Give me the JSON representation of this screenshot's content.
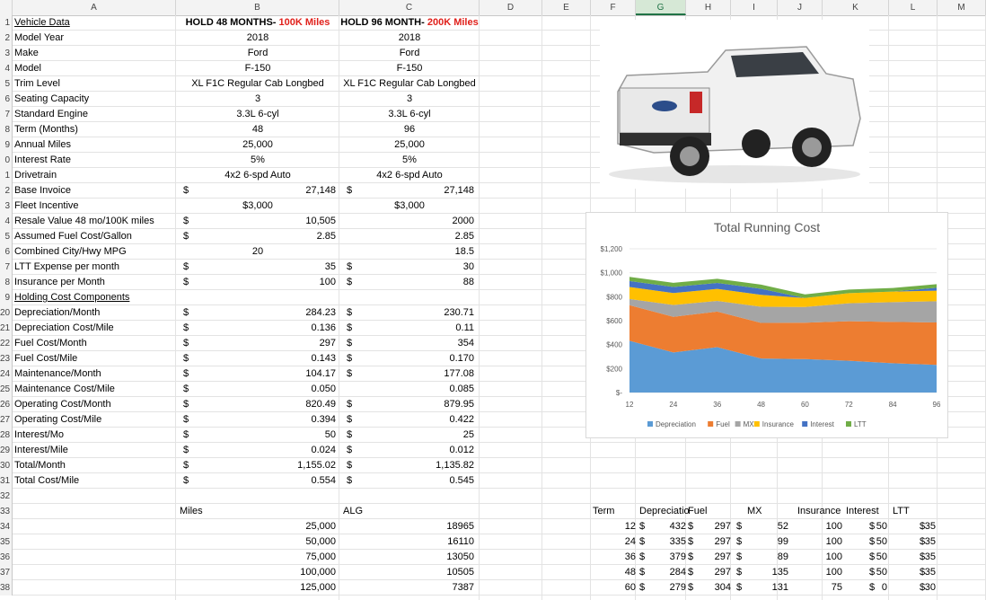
{
  "columns": [
    "A",
    "B",
    "C",
    "D",
    "E",
    "F",
    "G",
    "H",
    "I",
    "J",
    "K",
    "L",
    "M"
  ],
  "selected_column": "G",
  "row_numbers": [
    "1",
    "2",
    "3",
    "4",
    "5",
    "6",
    "7",
    "8",
    "9",
    "0",
    "1",
    "2",
    "3",
    "4",
    "5",
    "6",
    "7",
    "8",
    "9",
    "20",
    "21",
    "22",
    "23",
    "24",
    "25",
    "26",
    "27",
    "28",
    "29",
    "30",
    "31",
    "32",
    "33",
    "34",
    "35",
    "36",
    "37",
    "38"
  ],
  "header": {
    "label": "Vehicle Data",
    "hold48_prefix": "HOLD 48 MONTHS- ",
    "hold48_red": "100K Miles",
    "hold96_prefix": "HOLD 96 MONTH- ",
    "hold96_red": "200K Miles"
  },
  "rows": [
    {
      "label": "Model Year",
      "b": "2018",
      "c": "2018",
      "sb": "",
      "sc": ""
    },
    {
      "label": "Make",
      "b": "Ford",
      "c": "Ford",
      "sb": "",
      "sc": ""
    },
    {
      "label": "Model",
      "b": "F-150",
      "c": "F-150",
      "sb": "",
      "sc": ""
    },
    {
      "label": "Trim Level",
      "b": "XL F1C Regular Cab Longbed",
      "c": "XL F1C Regular Cab Longbed",
      "sb": "",
      "sc": ""
    },
    {
      "label": "Seating Capacity",
      "b": "3",
      "c": "3",
      "sb": "",
      "sc": ""
    },
    {
      "label": "Standard Engine",
      "b": "3.3L 6-cyl",
      "c": "3.3L 6-cyl",
      "sb": "",
      "sc": ""
    },
    {
      "label": "Term (Months)",
      "b": "48",
      "c": "96",
      "sb": "",
      "sc": ""
    },
    {
      "label": "Annual Miles",
      "b": "25,000",
      "c": "25,000",
      "sb": "",
      "sc": ""
    },
    {
      "label": "Interest Rate",
      "b": "5%",
      "c": "5%",
      "sb": "",
      "sc": ""
    },
    {
      "label": "Drivetrain",
      "b": "4x2 6-spd Auto",
      "c": "4x2 6-spd Auto",
      "sb": "",
      "sc": ""
    },
    {
      "label": "Base Invoice",
      "b": "27,148",
      "c": "27,148",
      "sb": "$",
      "sc": "$",
      "br": true,
      "cr": true
    },
    {
      "label": "Fleet Incentive",
      "b": "$3,000",
      "c": "$3,000",
      "sb": "",
      "sc": ""
    },
    {
      "label": "Resale Value 48 mo/100K miles",
      "b": "10,505",
      "c": "2000",
      "sb": "$",
      "sc": "",
      "br": true,
      "cr": true
    },
    {
      "label": "Assumed Fuel Cost/Gallon",
      "b": "2.85",
      "c": "2.85",
      "sb": "$",
      "sc": "",
      "br": true,
      "cr": true
    },
    {
      "label": "Combined City/Hwy MPG",
      "b": "20",
      "c": "18.5",
      "sb": "",
      "sc": "",
      "cr": true
    },
    {
      "label": "LTT Expense per month",
      "b": "35",
      "c": "30",
      "sb": "$",
      "sc": "$",
      "br": true,
      "cr": true
    },
    {
      "label": "Insurance per Month",
      "b": "100",
      "c": "88",
      "sb": "$",
      "sc": "$",
      "br": true,
      "cr": true
    },
    {
      "label": "Holding Cost Components",
      "b": "",
      "c": "",
      "sb": "",
      "sc": "",
      "u": true
    },
    {
      "label": "Depreciation/Month",
      "b": "284.23",
      "c": "230.71",
      "sb": "$",
      "sc": "$",
      "br": true,
      "cr": true
    },
    {
      "label": "Depreciation Cost/Mile",
      "b": "0.136",
      "c": "0.11",
      "sb": "$",
      "sc": "$",
      "br": true,
      "cr": true
    },
    {
      "label": "Fuel Cost/Month",
      "b": "297",
      "c": "354",
      "sb": "$",
      "sc": "$",
      "br": true,
      "cr": true
    },
    {
      "label": "Fuel Cost/Mile",
      "b": "0.143",
      "c": "0.170",
      "sb": "$",
      "sc": "$",
      "br": true,
      "cr": true
    },
    {
      "label": "Maintenance/Month",
      "b": "104.17",
      "c": "177.08",
      "sb": "$",
      "sc": "$",
      "br": true,
      "cr": true
    },
    {
      "label": "Maintenance Cost/Mile",
      "b": "0.050",
      "c": "0.085",
      "sb": "$",
      "sc": "",
      "br": true,
      "cr": true
    },
    {
      "label": "Operating Cost/Month",
      "b": "820.49",
      "c": "879.95",
      "sb": "$",
      "sc": "$",
      "br": true,
      "cr": true
    },
    {
      "label": "Operating Cost/Mile",
      "b": "0.394",
      "c": "0.422",
      "sb": "$",
      "sc": "$",
      "br": true,
      "cr": true
    },
    {
      "label": "Interest/Mo",
      "b": "50",
      "c": "25",
      "sb": "$",
      "sc": "$",
      "br": true,
      "cr": true
    },
    {
      "label": "Interest/Mile",
      "b": "0.024",
      "c": "0.012",
      "sb": "$",
      "sc": "$",
      "br": true,
      "cr": true
    },
    {
      "label": "Total/Month",
      "b": "1,155.02",
      "c": "1,135.82",
      "sb": "$",
      "sc": "$",
      "br": true,
      "cr": true
    },
    {
      "label": "Total Cost/Mile",
      "b": "0.554",
      "c": "0.545",
      "sb": "$",
      "sc": "$",
      "br": true,
      "cr": true
    }
  ],
  "miles_table": {
    "miles_header": "Miles",
    "alg_header": "ALG",
    "rows": [
      {
        "miles": "25,000",
        "alg": "18965"
      },
      {
        "miles": "50,000",
        "alg": "16110"
      },
      {
        "miles": "75,000",
        "alg": "13050"
      },
      {
        "miles": "100,000",
        "alg": "10505"
      },
      {
        "miles": "125,000",
        "alg": "7387"
      }
    ]
  },
  "term_table": {
    "headers": [
      "Term",
      "Depreciatio",
      "Fuel",
      "MX",
      "Insurance",
      "Interest",
      "LTT"
    ],
    "rows": [
      {
        "term": "12",
        "dep": "432",
        "fuel": "297",
        "mx": "52",
        "ins": "100",
        "int": "50",
        "ltt": "35"
      },
      {
        "term": "24",
        "dep": "335",
        "fuel": "297",
        "mx": "99",
        "ins": "100",
        "int": "50",
        "ltt": "35"
      },
      {
        "term": "36",
        "dep": "379",
        "fuel": "297",
        "mx": "89",
        "ins": "100",
        "int": "50",
        "ltt": "35"
      },
      {
        "term": "48",
        "dep": "284",
        "fuel": "297",
        "mx": "135",
        "ins": "100",
        "int": "50",
        "ltt": "35"
      },
      {
        "term": "60",
        "dep": "279",
        "fuel": "304",
        "mx": "131",
        "ins": "75",
        "int": "0",
        "ltt": "30"
      }
    ]
  },
  "chart_data": {
    "type": "area",
    "title": "Total Running Cost",
    "x": [
      12,
      24,
      36,
      48,
      60,
      72,
      84,
      96
    ],
    "ylim": [
      0,
      1200
    ],
    "yticks": [
      "$-",
      "$200",
      "$400",
      "$600",
      "$800",
      "$1,000",
      "$1,200"
    ],
    "legend_position": "bottom",
    "series": [
      {
        "name": "Depreciation",
        "color": "#5b9bd5",
        "values": [
          432,
          335,
          379,
          284,
          279,
          265,
          245,
          231
        ]
      },
      {
        "name": "Fuel",
        "color": "#ed7d31",
        "values": [
          297,
          297,
          297,
          297,
          304,
          330,
          345,
          354
        ]
      },
      {
        "name": "MX",
        "color": "#a5a5a5",
        "values": [
          52,
          99,
          89,
          135,
          131,
          150,
          165,
          177
        ]
      },
      {
        "name": "Insurance",
        "color": "#ffc000",
        "values": [
          100,
          100,
          100,
          100,
          75,
          85,
          88,
          88
        ]
      },
      {
        "name": "Interest",
        "color": "#4472c4",
        "values": [
          50,
          50,
          50,
          50,
          0,
          0,
          0,
          25
        ]
      },
      {
        "name": "LTT",
        "color": "#70ad47",
        "values": [
          35,
          35,
          35,
          35,
          30,
          30,
          30,
          30
        ]
      }
    ]
  }
}
